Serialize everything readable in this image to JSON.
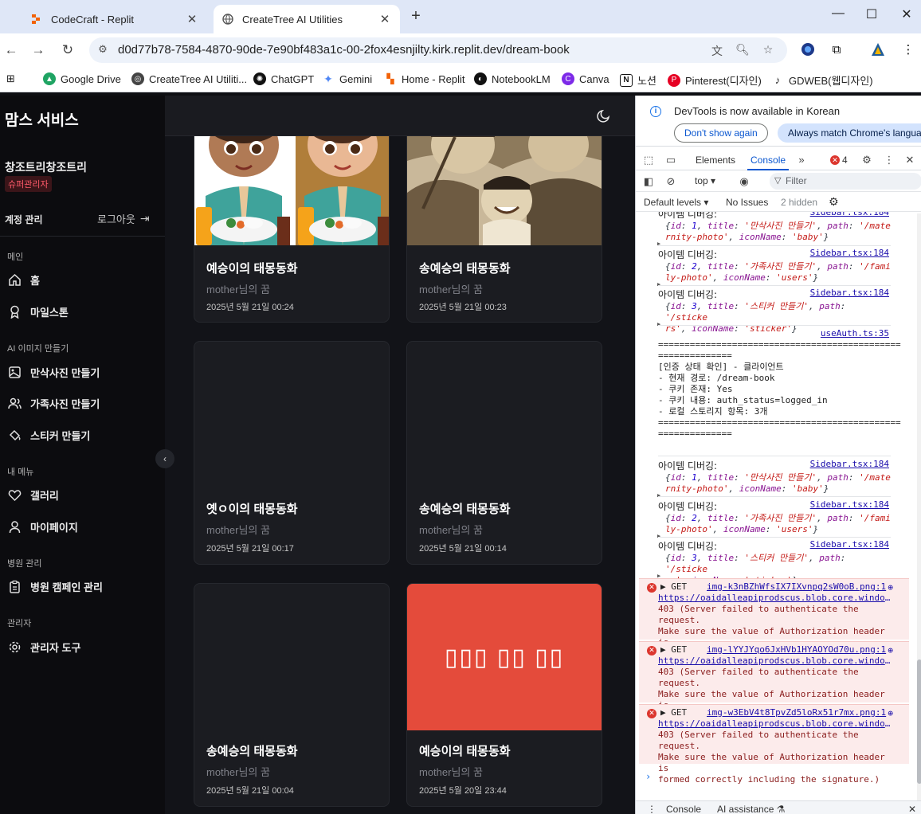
{
  "browser": {
    "tabs": [
      {
        "title": "CodeCraft - Replit",
        "active": false
      },
      {
        "title": "CreateTree AI Utilities",
        "active": true
      }
    ],
    "new_tab": "+",
    "url": "d0d77b78-7584-4870-90de-7e90bf483a1c-00-2fox4esnjilty.kirk.replit.dev/dream-book",
    "bookmarks": [
      {
        "label": "Google Drive",
        "color": "#1fa463"
      },
      {
        "label": "CreateTree AI Utiliti...",
        "color": "#444444"
      },
      {
        "label": "ChatGPT",
        "color": "#111111"
      },
      {
        "label": "Gemini",
        "color": "#4e86f5"
      },
      {
        "label": "Home - Replit",
        "color": "#f26207"
      },
      {
        "label": "NotebookLM",
        "color": "#111111"
      },
      {
        "label": "Canva",
        "color": "#7d2ae8"
      },
      {
        "label": "노션",
        "color": "#111111"
      },
      {
        "label": "Pinterest(디자인)",
        "color": "#e60023"
      },
      {
        "label": "GDWEB(웹디자인)",
        "color": "#222222"
      }
    ]
  },
  "sidebar": {
    "brand": "맘스 서비스",
    "user": "창조트리창조트리",
    "role": "슈퍼관리자",
    "account_label": "계정 관리",
    "logout": "로그아웃",
    "sections": {
      "main": "메인",
      "ai_images": "AI 이미지 만들기",
      "my_menu": "내 메뉴",
      "hospital": "병원 관리",
      "admin": "관리자"
    },
    "items": {
      "home": "홈",
      "milestone": "마일스톤",
      "maternity": "만삭사진 만들기",
      "family": "가족사진 만들기",
      "sticker": "스티커 만들기",
      "gallery": "갤러리",
      "mypage": "마이페이지",
      "campaign": "병원 캠페인 관리",
      "admin_tools": "관리자 도구"
    }
  },
  "cards": [
    {
      "title": "예승이의 태몽동화",
      "owner": "mother님의 꿈",
      "date": "2025년 5월 21일 00:24"
    },
    {
      "title": "송예승의 태몽동화",
      "owner": "mother님의 꿈",
      "date": "2025년 5월 21일 00:23"
    },
    {
      "title": "옛ㅇ이의 태몽동화",
      "owner": "mother님의 꿈",
      "date": "2025년 5월 21일 00:17"
    },
    {
      "title": "송예승의 태몽동화",
      "owner": "mother님의 꿈",
      "date": "2025년 5월 21일 00:14"
    },
    {
      "title": "송예승의 태몽동화",
      "owner": "mother님의 꿈",
      "date": "2025년 5월 21일 00:04"
    },
    {
      "title": "예승이의 태몽동화",
      "owner": "mother님의 꿈",
      "date": "2025년 5월 20일 23:44",
      "placeholder": "▯▯▯ ▯▯ ▯▯",
      "placeholder_color": "#e44b3b"
    }
  ],
  "devtools": {
    "banner": "DevTools is now available in Korean",
    "dont_show": "Don't show again",
    "always_match": "Always match Chrome's langua",
    "tabs": {
      "elements": "Elements",
      "console": "Console"
    },
    "error_count": "4",
    "context": "top ▾",
    "filter_placeholder": "Filter",
    "levels": "Default levels ▾",
    "issues": "No Issues",
    "hidden": "2 hidden",
    "debug_label": "아이템 디버깅:",
    "sidebar_src": "Sidebar.tsx:184",
    "auth_src": "useAuth.ts:35",
    "auth_log": "==============================================\n==============\n[인증 상태 확인] - 클라이언트\n- 현재 경로: /dream-book\n- 쿠키 존재: Yes\n- 쿠키 내용: auth_status=logged_in\n- 로컬 스토리지 항목: 3개\n==============================================\n==============",
    "items": [
      {
        "id": "1",
        "title": "'만삭사진 만들기'",
        "path": "'/mate",
        "path2": "rnity-photo'",
        "icon": "'baby'"
      },
      {
        "id": "2",
        "title": "'가족사진 만들기'",
        "path": "'/fami",
        "path2": "ly-photo'",
        "icon": "'users'"
      },
      {
        "id": "3",
        "title": "'스티커 만들기'",
        "path": "'/sticke",
        "path2": "rs'",
        "icon": "'sticker'"
      }
    ],
    "errors": [
      {
        "method": "▶ GET",
        "file": "img-k3nBZhWfsIX7IXvnpq2sW0oB.png:1",
        "url": "https://oaidalleapiprodscus.blob.core.windows.net/",
        "message": "403 (Server failed to authenticate the request.\nMake sure the value of Authorization header is\nformed correctly including the signature.)"
      },
      {
        "method": "▶ GET",
        "file": "img-lYYJYqo6JxHVb1HYAOYOd70u.png:1",
        "url": "https://oaidalleapiprodscus.blob.core.windows.net/",
        "message": "403 (Server failed to authenticate the request.\nMake sure the value of Authorization header is\nformed correctly including the signature.)"
      },
      {
        "method": "▶ GET",
        "file": "img-w3EbV4t8TpvZd5loRx51r7mx.png:1",
        "url": "https://oaidalleapiprodscus.blob.core.windows.net/",
        "message": "403 (Server failed to authenticate the request.\nMake sure the value of Authorization header is\nformed correctly including the signature.)"
      }
    ],
    "prompt": "›",
    "drawer": {
      "console": "Console",
      "ai": "AI assistance ⚗"
    }
  }
}
